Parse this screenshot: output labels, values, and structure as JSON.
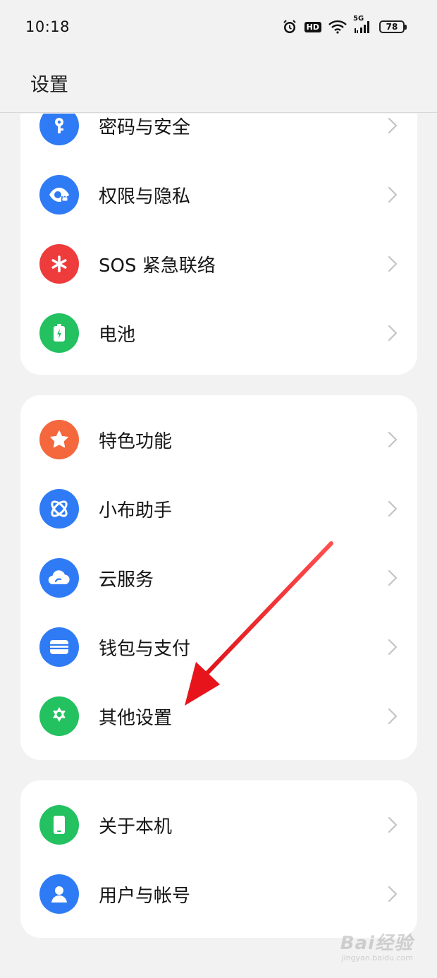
{
  "status_bar": {
    "time": "10:18",
    "network": "5G",
    "battery": "78",
    "hd_label": "HD"
  },
  "header": {
    "title": "设置"
  },
  "groups": [
    {
      "items": [
        {
          "label": "密码与安全",
          "icon": "key-icon",
          "color": "#2f7bf5"
        },
        {
          "label": "权限与隐私",
          "icon": "privacy-eye-icon",
          "color": "#2f7bf5"
        },
        {
          "label": "SOS 紧急联络",
          "icon": "sos-asterisk-icon",
          "color": "#ee3b3b"
        },
        {
          "label": "电池",
          "icon": "battery-icon",
          "color": "#23c160"
        }
      ]
    },
    {
      "items": [
        {
          "label": "特色功能",
          "icon": "star-icon",
          "color": "#f5683e"
        },
        {
          "label": "小布助手",
          "icon": "assistant-icon",
          "color": "#2f7bf5"
        },
        {
          "label": "云服务",
          "icon": "cloud-icon",
          "color": "#2f7bf5"
        },
        {
          "label": "钱包与支付",
          "icon": "wallet-icon",
          "color": "#2f7bf5"
        },
        {
          "label": "其他设置",
          "icon": "gear-icon",
          "color": "#23c160"
        }
      ]
    },
    {
      "items": [
        {
          "label": "关于本机",
          "icon": "phone-icon",
          "color": "#23c160"
        },
        {
          "label": "用户与帐号",
          "icon": "user-icon",
          "color": "#2f7bf5"
        }
      ]
    }
  ],
  "annotation": {
    "arrow_color": "#e8141b"
  },
  "watermark": {
    "main": "Bai经验",
    "sub": "jingyan.baidu.com"
  }
}
